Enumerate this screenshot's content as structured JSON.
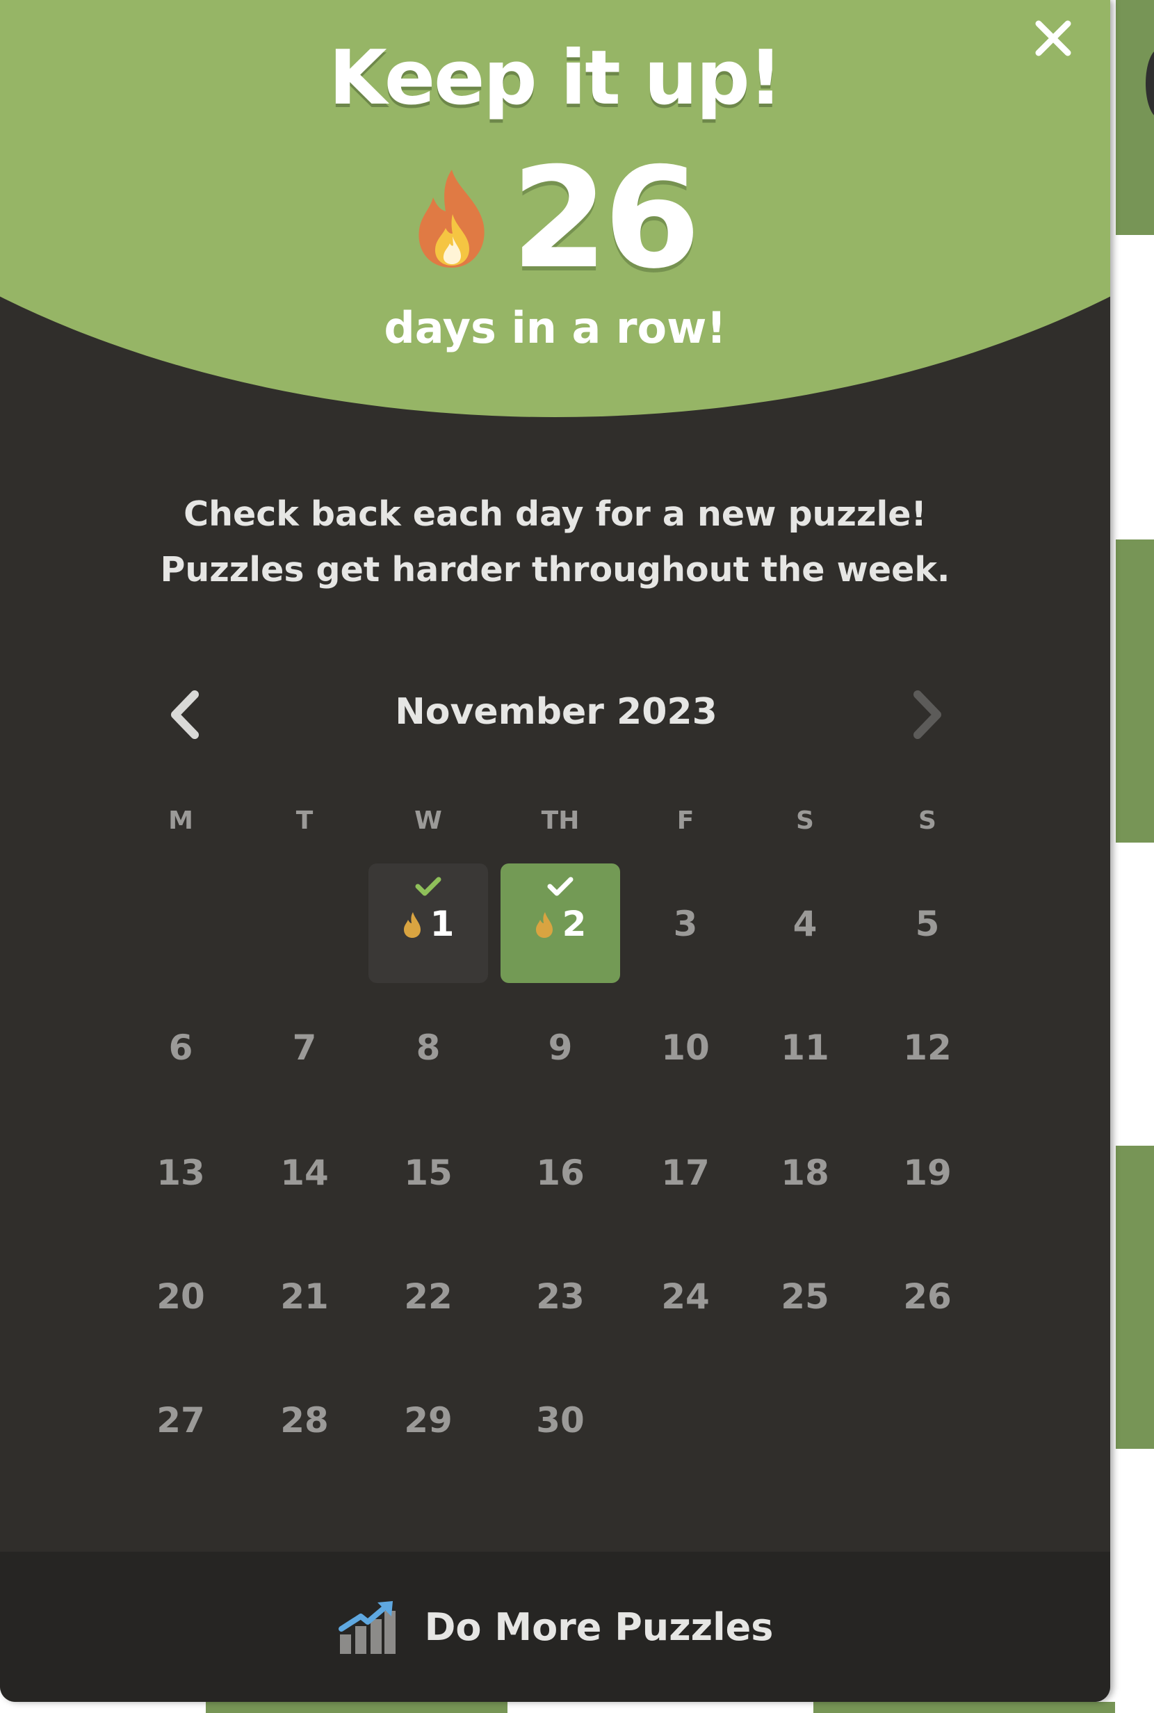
{
  "modal": {
    "title": "Keep it up!",
    "streak": {
      "count": "26",
      "subtitle": "days in a row!"
    },
    "info_line1": "Check back each day for a new puzzle!",
    "info_line2": "Puzzles get harder throughout the week.",
    "close_icon": "close-icon"
  },
  "calendar": {
    "month_label": "November 2023",
    "weekdays": [
      "M",
      "T",
      "W",
      "TH",
      "F",
      "S",
      "S"
    ],
    "days": [
      {
        "num": "1",
        "col": 2,
        "row": 0,
        "status": "completed"
      },
      {
        "num": "2",
        "col": 3,
        "row": 0,
        "status": "completed-today"
      },
      {
        "num": "3",
        "col": 4,
        "row": 0,
        "status": ""
      },
      {
        "num": "4",
        "col": 5,
        "row": 0,
        "status": ""
      },
      {
        "num": "5",
        "col": 6,
        "row": 0,
        "status": ""
      },
      {
        "num": "6",
        "col": 0,
        "row": 1,
        "status": ""
      },
      {
        "num": "7",
        "col": 1,
        "row": 1,
        "status": ""
      },
      {
        "num": "8",
        "col": 2,
        "row": 1,
        "status": ""
      },
      {
        "num": "9",
        "col": 3,
        "row": 1,
        "status": ""
      },
      {
        "num": "10",
        "col": 4,
        "row": 1,
        "status": ""
      },
      {
        "num": "11",
        "col": 5,
        "row": 1,
        "status": ""
      },
      {
        "num": "12",
        "col": 6,
        "row": 1,
        "status": ""
      },
      {
        "num": "13",
        "col": 0,
        "row": 2,
        "status": ""
      },
      {
        "num": "14",
        "col": 1,
        "row": 2,
        "status": ""
      },
      {
        "num": "15",
        "col": 2,
        "row": 2,
        "status": ""
      },
      {
        "num": "16",
        "col": 3,
        "row": 2,
        "status": ""
      },
      {
        "num": "17",
        "col": 4,
        "row": 2,
        "status": ""
      },
      {
        "num": "18",
        "col": 5,
        "row": 2,
        "status": ""
      },
      {
        "num": "19",
        "col": 6,
        "row": 2,
        "status": ""
      },
      {
        "num": "20",
        "col": 0,
        "row": 3,
        "status": ""
      },
      {
        "num": "21",
        "col": 1,
        "row": 3,
        "status": ""
      },
      {
        "num": "22",
        "col": 2,
        "row": 3,
        "status": ""
      },
      {
        "num": "23",
        "col": 3,
        "row": 3,
        "status": ""
      },
      {
        "num": "24",
        "col": 4,
        "row": 3,
        "status": ""
      },
      {
        "num": "25",
        "col": 5,
        "row": 3,
        "status": ""
      },
      {
        "num": "26",
        "col": 6,
        "row": 3,
        "status": ""
      },
      {
        "num": "27",
        "col": 0,
        "row": 4,
        "status": ""
      },
      {
        "num": "28",
        "col": 1,
        "row": 4,
        "status": ""
      },
      {
        "num": "29",
        "col": 2,
        "row": 4,
        "status": ""
      },
      {
        "num": "30",
        "col": 3,
        "row": 4,
        "status": ""
      }
    ]
  },
  "footer": {
    "label": "Do More Puzzles",
    "icon": "chart-up-icon"
  },
  "colors": {
    "header_green": "#96b566",
    "modal_bg": "#302e2b",
    "today_green": "#739a55",
    "footer_bg": "#262523",
    "muted_text": "#9b9a98"
  }
}
